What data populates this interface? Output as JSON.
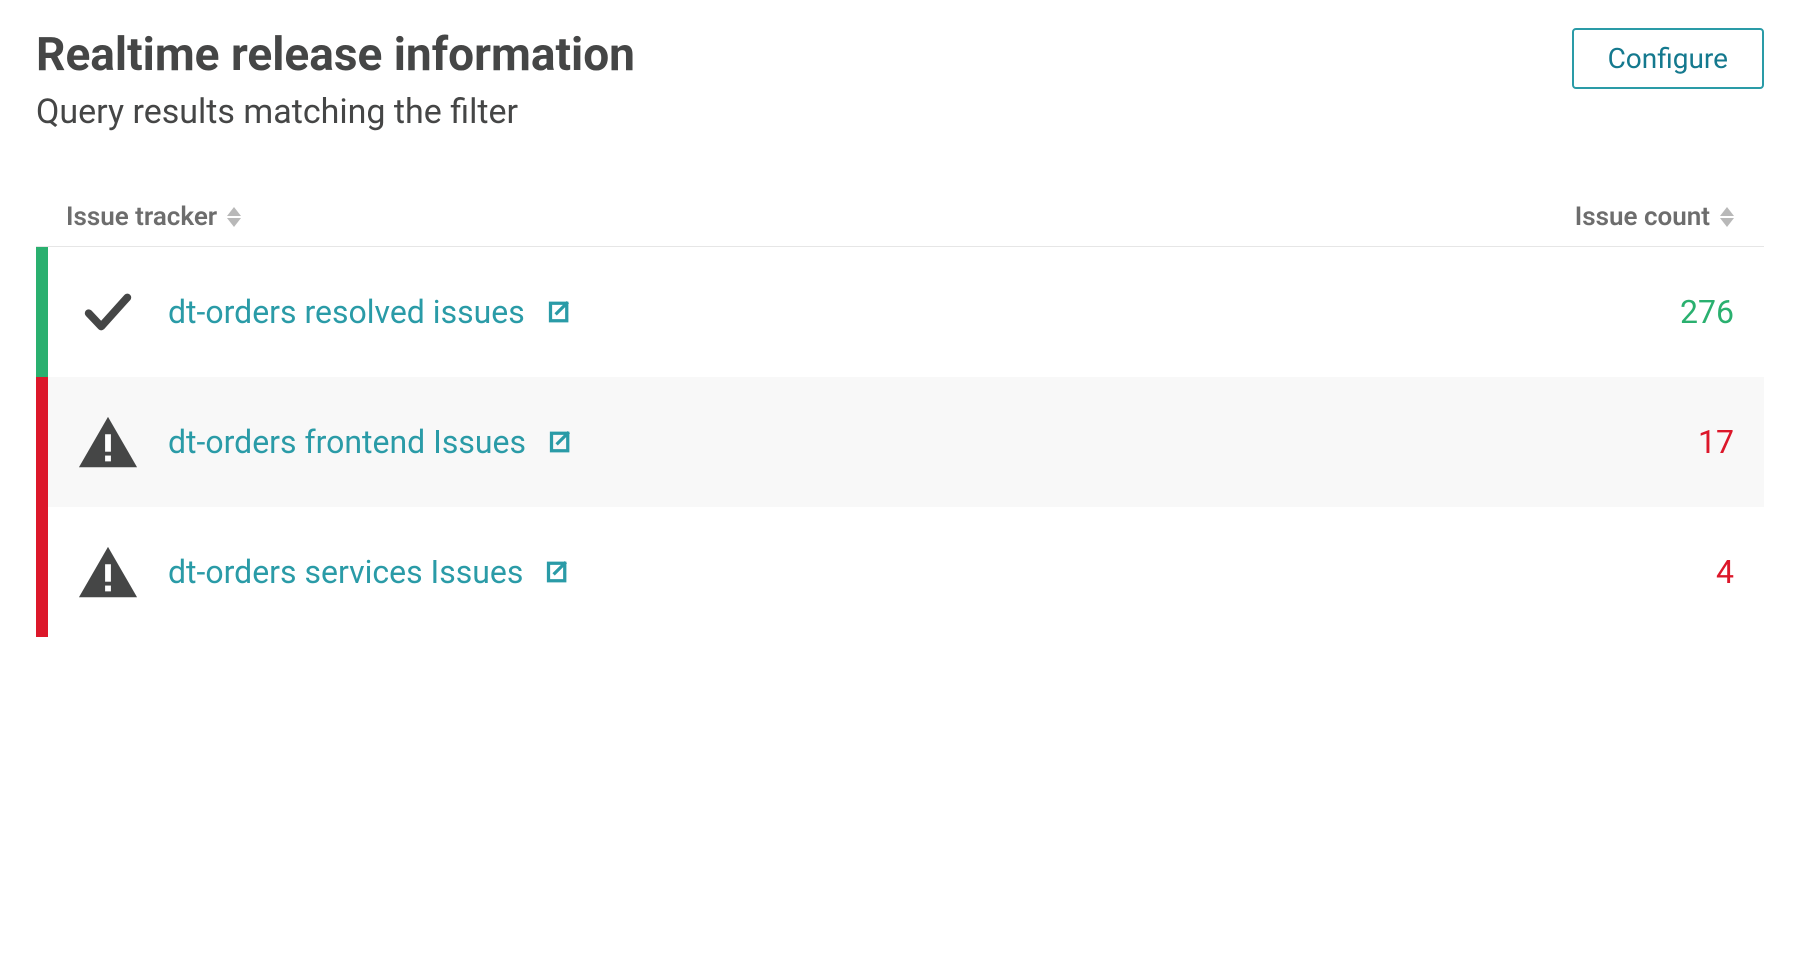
{
  "header": {
    "title": "Realtime release information",
    "subtitle": "Query results matching the filter",
    "configure_label": "Configure"
  },
  "table": {
    "columns": {
      "tracker_label": "Issue tracker",
      "count_label": "Issue count"
    },
    "rows": [
      {
        "status": "ok",
        "label": "dt-orders resolved issues",
        "count": "276",
        "count_color": "green",
        "bar_color": "green"
      },
      {
        "status": "alert",
        "label": "dt-orders frontend Issues",
        "count": "17",
        "count_color": "red",
        "bar_color": "red"
      },
      {
        "status": "alert",
        "label": "dt-orders services Issues",
        "count": "4",
        "count_color": "red",
        "bar_color": "red"
      }
    ]
  }
}
